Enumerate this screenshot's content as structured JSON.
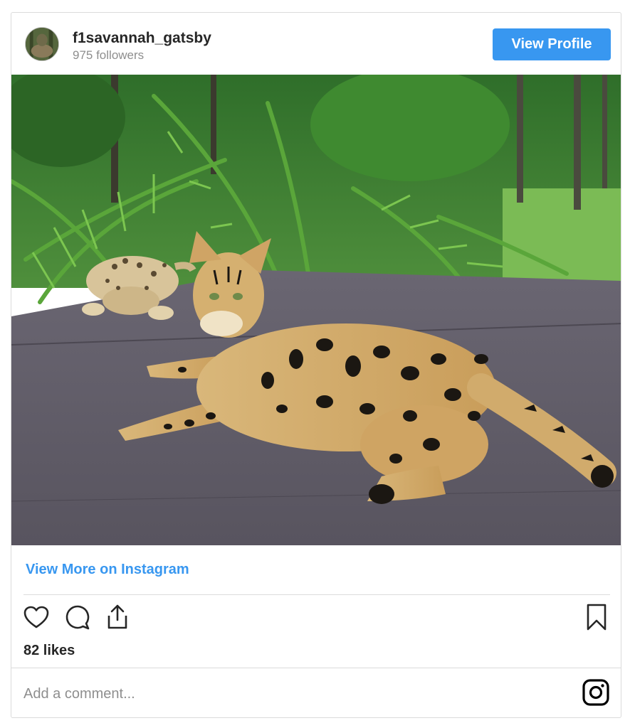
{
  "header": {
    "username": "f1savannah_gatsby",
    "followers": "975 followers",
    "view_profile_label": "View Profile"
  },
  "post": {
    "image_icon": "savannah-cats-photo",
    "view_more_label": "View More on Instagram",
    "likes": "82 likes"
  },
  "actions": {
    "like_icon": "heart-icon",
    "comment_icon": "comment-icon",
    "share_icon": "share-icon",
    "save_icon": "bookmark-icon"
  },
  "comment": {
    "placeholder": "Add a comment..."
  },
  "colors": {
    "accent": "#3897f0",
    "text": "#262626",
    "muted": "#8e8e8e",
    "border": "#dbdbdb"
  }
}
